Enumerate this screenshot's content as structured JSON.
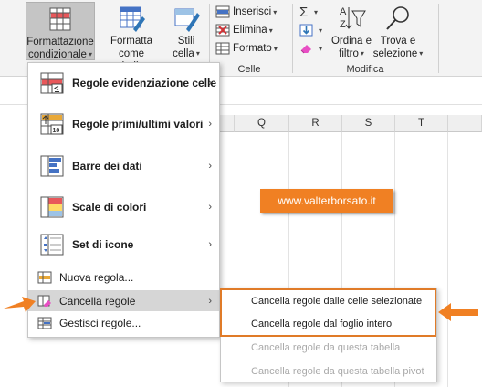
{
  "ribbon": {
    "conditional_formatting": {
      "line1": "Formattazione",
      "line2": "condizionale"
    },
    "format_as_table": {
      "line1": "Formatta come",
      "line2": "tabella"
    },
    "cell_styles": {
      "line1": "Stili",
      "line2": "cella"
    },
    "insert": "Inserisci",
    "delete": "Elimina",
    "format": "Formato",
    "cells_group": "Celle",
    "sort_filter": {
      "line1": "Ordina e",
      "line2": "filtro"
    },
    "find_select": {
      "line1": "Trova e",
      "line2": "selezione"
    },
    "editing_group": "Modifica",
    "sum_symbol": "Σ",
    "sort_icon_letters": {
      "top": "A",
      "bottom": "Z"
    }
  },
  "columns": [
    "Q",
    "R",
    "S",
    "T"
  ],
  "menu": {
    "highlight_rules": "Regole evidenziazione celle",
    "top_bottom_rules": "Regole primi/ultimi valori",
    "data_bars": "Barre dei dati",
    "color_scales": "Scale di colori",
    "icon_sets": "Set di icone",
    "new_rule": "Nuova regola...",
    "clear_rules": "Cancella regole",
    "manage_rules": "Gestisci regole...",
    "top_bottom_icon_digits": "10",
    "submenu_arrow": "›"
  },
  "submenu": {
    "clear_selected": "Cancella regole dalle celle selezionate",
    "clear_sheet": "Cancella regole dal foglio intero",
    "clear_table": "Cancella regole da questa tabella",
    "clear_pivot": "Cancella regole da questa tabella pivot"
  },
  "watermark": "www.valterborsato.it",
  "colors": {
    "accent_orange": "#f08023",
    "menu_highlight": "#d6d6d6",
    "disabled_text": "#a9a9a9"
  }
}
